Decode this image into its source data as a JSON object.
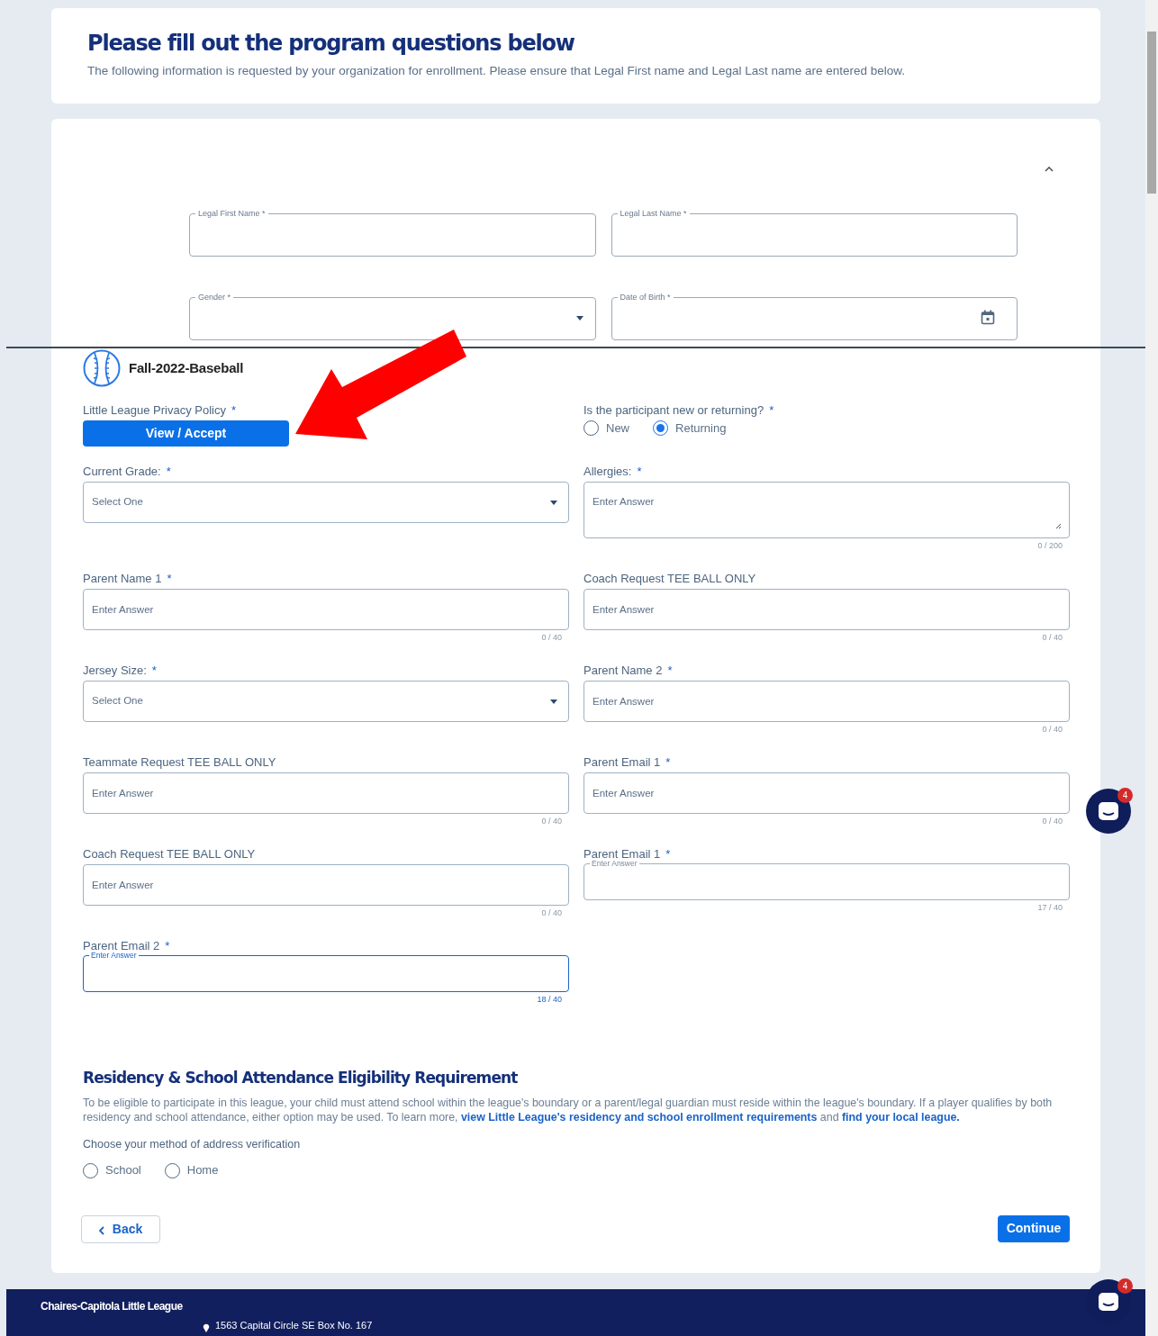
{
  "header": {
    "title": "Please fill out the program questions below",
    "subtitle": "The following information is requested by your organization for enrollment. Please ensure that Legal First name and Legal Last name are entered below."
  },
  "participant": {
    "expanded": true,
    "fields": [
      {
        "kind": "text",
        "label": "Legal First Name *"
      },
      {
        "kind": "text",
        "label": "Legal Last Name *"
      },
      {
        "kind": "select",
        "label": "Gender *"
      },
      {
        "kind": "date",
        "label": "Date of Birth *"
      }
    ]
  },
  "program": {
    "name": "Fall-2022-Baseball"
  },
  "questions": [
    {
      "kind": "button",
      "label": "Little League Privacy Policy",
      "required_mark": "*",
      "button_label": "View / Accept"
    },
    {
      "kind": "radio",
      "label": "Is the participant new or returning?",
      "required_mark": "*",
      "options": [
        {
          "label": "New",
          "selected": false
        },
        {
          "label": "Returning",
          "selected": true
        }
      ]
    },
    {
      "kind": "select",
      "label": "Current Grade:",
      "required_mark": "*",
      "placeholder": "Select One"
    },
    {
      "kind": "textarea",
      "label": "Allergies:",
      "required_mark": "*",
      "placeholder": "Enter Answer",
      "counter": "0 / 200"
    },
    {
      "kind": "text",
      "label": "Parent Name 1",
      "required_mark": "*",
      "placeholder": "Enter Answer",
      "counter": "0 / 40",
      "floating": false,
      "focused": false
    },
    {
      "kind": "text",
      "label": "Coach Request TEE BALL ONLY",
      "placeholder": "Enter Answer",
      "counter": "0 / 40",
      "floating": false,
      "focused": false
    },
    {
      "kind": "select",
      "label": "Jersey Size:",
      "required_mark": "*",
      "placeholder": "Select One"
    },
    {
      "kind": "text",
      "label": "Parent Name 2",
      "required_mark": "*",
      "placeholder": "Enter Answer",
      "counter": "0 / 40",
      "floating": false,
      "focused": false
    },
    {
      "kind": "text",
      "label": "Teammate Request TEE BALL ONLY",
      "placeholder": "Enter Answer",
      "counter": "0 / 40",
      "floating": false,
      "focused": false
    },
    {
      "kind": "text",
      "label": "Parent Email 1",
      "required_mark": "*",
      "placeholder": "Enter Answer",
      "counter": "0 / 40",
      "floating": false,
      "focused": false
    },
    {
      "kind": "text",
      "label": "Coach Request TEE BALL ONLY",
      "placeholder": "Enter Answer",
      "counter": "0 / 40",
      "floating": false,
      "focused": false
    },
    {
      "kind": "text",
      "label": "Parent Email 1",
      "required_mark": "*",
      "placeholder": "Enter Answer",
      "counter": "17 / 40",
      "floating": true,
      "focused": false
    },
    {
      "kind": "text",
      "label": "Parent Email 2",
      "required_mark": "*",
      "placeholder": "Enter Answer",
      "counter": "18 / 40",
      "floating": true,
      "focused": true
    }
  ],
  "residency": {
    "title": "Residency & School Attendance Eligibility Requirement",
    "paragraph": [
      {
        "kind": "text",
        "text": "To be eligible to participate in this league, your child must attend school within the league's boundary or a parent/legal guardian must reside within the league's boundary. If a player qualifies by both residency and school attendance, either option may be used. To learn more,"
      },
      {
        "kind": "link",
        "text": "view Little League's residency and school enrollment requirements"
      },
      {
        "kind": "text",
        "text": "and"
      },
      {
        "kind": "link",
        "text": "find your local league."
      }
    ],
    "method_label": "Choose your method of address verification",
    "options": [
      {
        "label": "School",
        "selected": false
      },
      {
        "label": "Home",
        "selected": false
      }
    ]
  },
  "actions": {
    "back": "Back",
    "continue": "Continue"
  },
  "chat": [
    {
      "badge": "4"
    },
    {
      "badge": "4"
    }
  ],
  "footer": {
    "league": "Chaires-Capitola Little League",
    "address": "1563 Capital Circle SE Box No. 167"
  }
}
